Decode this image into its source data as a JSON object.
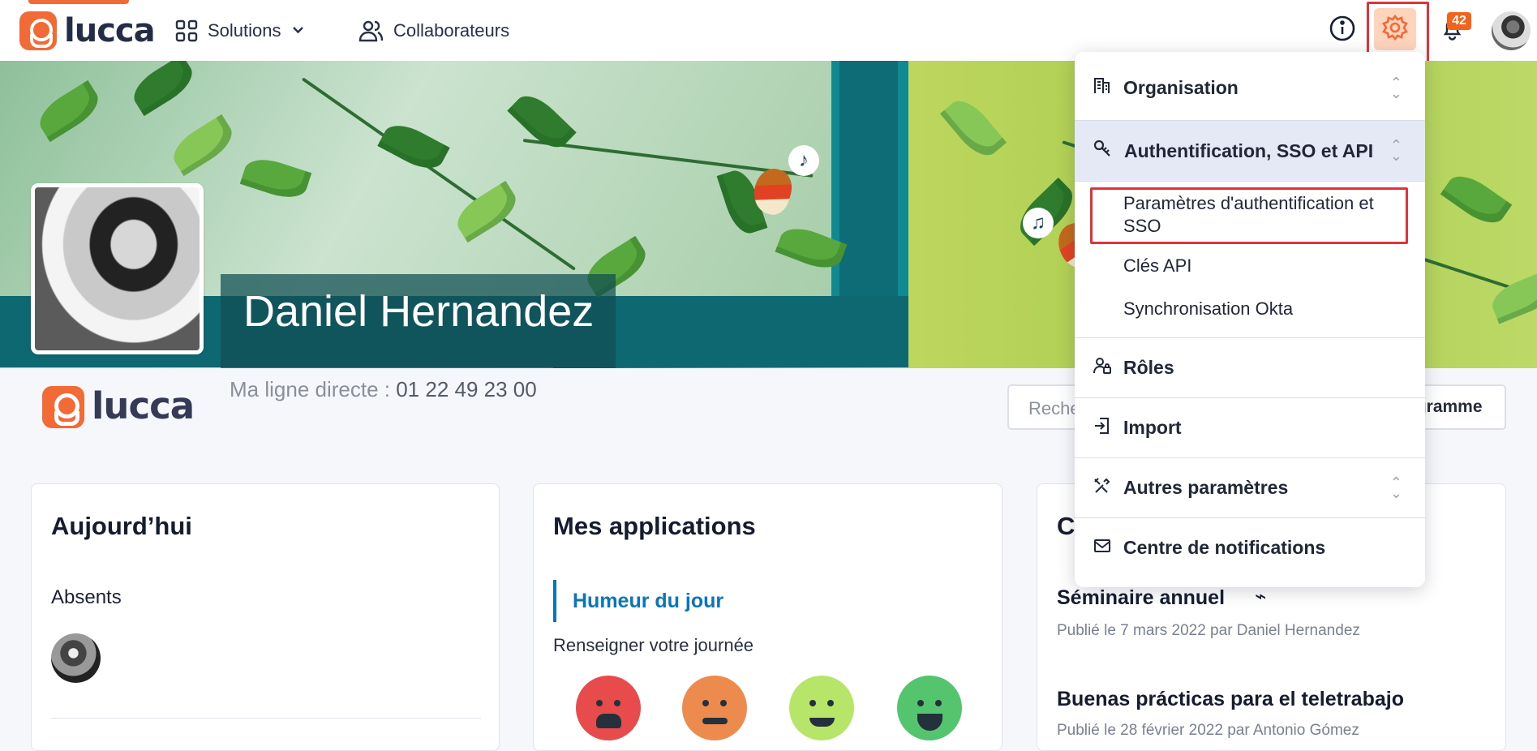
{
  "header": {
    "brand": "lucca",
    "solutions_label": "Solutions",
    "collaborators_label": "Collaborateurs",
    "notification_count": "42",
    "accent": "#f26a35"
  },
  "profile": {
    "name": "Daniel Hernandez",
    "direct_line_label": "Ma ligne directe :",
    "direct_line_value": "01 22 49 23 00",
    "company_logo": "lucca"
  },
  "search": {
    "visible_text": "Reche"
  },
  "org_button": {
    "visible_text": "igramme"
  },
  "cards": {
    "today": {
      "title": "Aujourd’hui",
      "absent_label": "Absents"
    },
    "apps": {
      "title": "Mes applications",
      "mood_label": "Humeur du jour",
      "mood_subtitle": "Renseigner votre journée"
    },
    "news": {
      "title_visible": "C",
      "items": [
        {
          "title": "Séminaire annuel",
          "meta": "Publié le 7 mars 2022 par Daniel Hernandez"
        },
        {
          "title": "Buenas prácticas para el teletrabajo",
          "meta": "Publié le 28 février 2022 par Antonio Gómez"
        }
      ]
    }
  },
  "settings_menu": {
    "items": [
      {
        "label": "Organisation",
        "icon": "building-icon"
      },
      {
        "label": "Authentification, SSO et API",
        "icon": "key-icon"
      },
      {
        "label": "Rôles",
        "icon": "user-lock-icon"
      },
      {
        "label": "Import",
        "icon": "import-icon"
      },
      {
        "label": "Autres paramètres",
        "icon": "tools-icon"
      },
      {
        "label": "Centre de notifications",
        "icon": "mail-icon"
      }
    ],
    "sub_items": [
      "Paramètres d'authentification et SSO",
      "Clés API",
      "Synchronisation Okta"
    ]
  },
  "moods": [
    "#e84b4b",
    "#ed8a4d",
    "#b7e56a",
    "#55c46f"
  ]
}
